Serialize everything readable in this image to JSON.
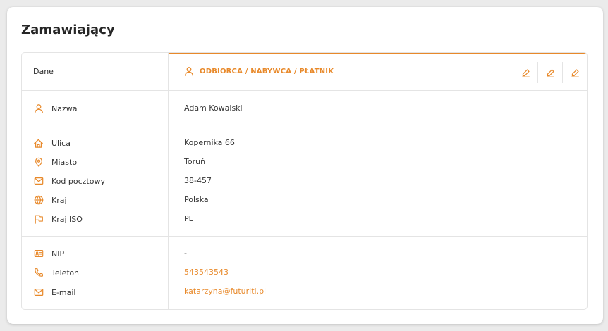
{
  "section": {
    "title": "Zamawiający"
  },
  "table": {
    "header_left": "Dane",
    "header_right": "ODBIORCA / NABYWCA / PŁATNIK"
  },
  "fields": {
    "name": {
      "label": "Nazwa",
      "value": "Adam Kowalski",
      "icon": "user-icon"
    },
    "street": {
      "label": "Ulica",
      "value": "Kopernika 66",
      "icon": "home-icon"
    },
    "city": {
      "label": "Miasto",
      "value": "Toruń",
      "icon": "map-pin-icon"
    },
    "postal": {
      "label": "Kod pocztowy",
      "value": "38-457",
      "icon": "mail-icon"
    },
    "country": {
      "label": "Kraj",
      "value": "Polska",
      "icon": "globe-icon"
    },
    "iso": {
      "label": "Kraj ISO",
      "value": "PL",
      "icon": "flag-icon"
    },
    "nip": {
      "label": "NIP",
      "value": "-",
      "icon": "id-card-icon"
    },
    "phone": {
      "label": "Telefon",
      "value": "543543543",
      "icon": "phone-icon"
    },
    "email": {
      "label": "E-mail",
      "value": "katarzyna@futuriti.pl",
      "icon": "mail-icon"
    }
  },
  "colors": {
    "accent": "#e8892a",
    "border": "#e4e4e4",
    "background": "#ebebeb"
  }
}
